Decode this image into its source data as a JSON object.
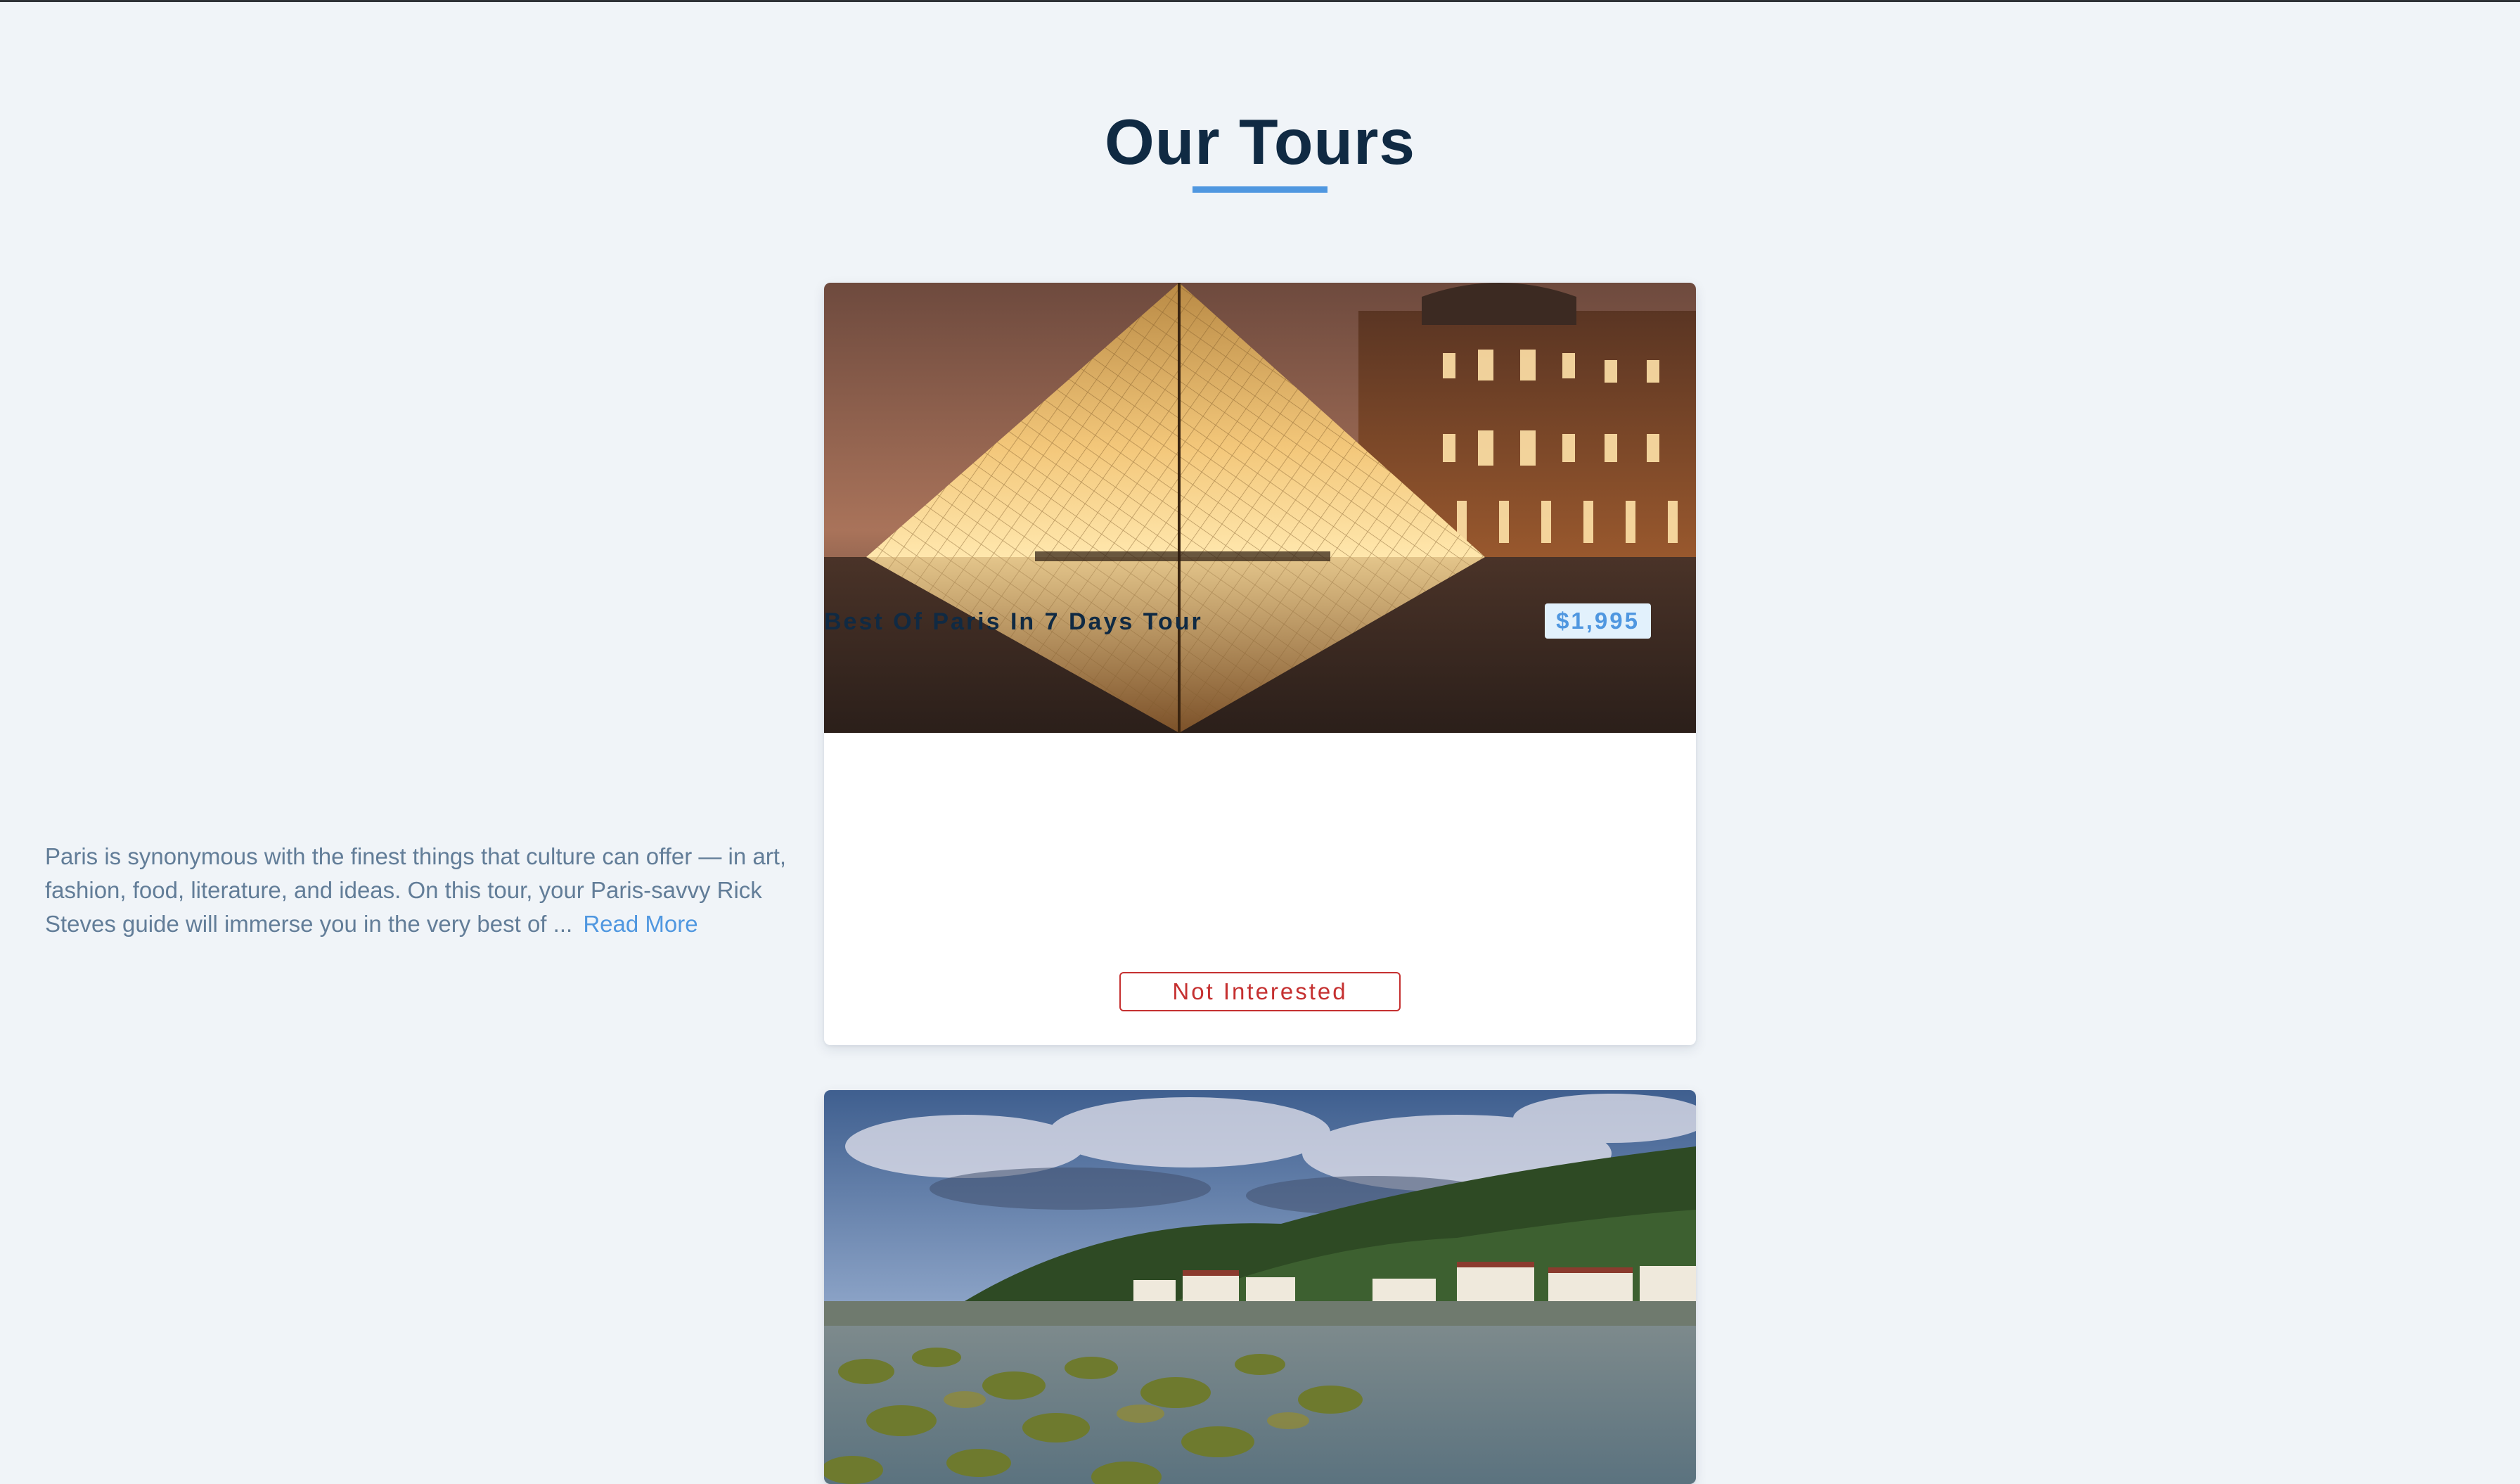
{
  "page": {
    "title": "Our Tours"
  },
  "colors": {
    "background": "#f0f4f8",
    "title": "#102a43",
    "accent": "#4f97e0",
    "text_muted": "#627d98",
    "danger": "#c53030",
    "price_bg": "#e2f1fc"
  },
  "tours": [
    {
      "name": "Best Of Paris In 7 Days Tour",
      "price": "$1,995",
      "description": "Paris is synonymous with the finest things that culture can offer — in art, fashion, food, literature, and ideas. On this tour, your Paris-savvy Rick Steves guide will immerse you in the very best of ...",
      "read_more_label": "Read More",
      "not_interested_label": "Not Interested"
    },
    {
      "name": "",
      "price": ""
    }
  ]
}
